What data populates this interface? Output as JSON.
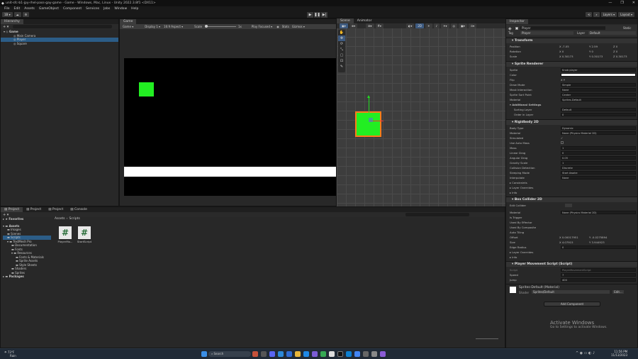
{
  "window": {
    "title": "unit-sfc-b1-jpy-rhel-pass-gay-game - Game - Windows, Mac, Linux - Unity 2022.3.8f1 <DX11>",
    "controls": [
      "—",
      "❐",
      "✕"
    ]
  },
  "menu": [
    "File",
    "Edit",
    "Assets",
    "GameObject",
    "Component",
    "Services",
    "Jobs",
    "Window",
    "Help"
  ],
  "toolbar": {
    "account": "1B",
    "layers": "Layers",
    "layout": "Layout"
  },
  "hierarchy": {
    "tab": "Hierarchy",
    "scene": "Game",
    "items": [
      "Main Camera",
      "Player",
      "Square"
    ]
  },
  "game": {
    "tab": "Game",
    "display_mode": "Game",
    "display": "Display 1",
    "aspect": "16:9 Aspect",
    "scale_label": "Scale",
    "scale_value": "1x",
    "play_focused": "Play Focused",
    "stats": "Stats",
    "gizmos": "Gizmos"
  },
  "scene": {
    "tab_scene": "Scene",
    "tab_animator": "Animator",
    "mode_2d": "2D"
  },
  "inspector": {
    "tab": "Inspector",
    "object_name": "Player",
    "static_label": "Static",
    "tag_label": "Tag",
    "tag_value": "Player",
    "layer_label": "Layer",
    "layer_value": "Default",
    "transform": {
      "title": "Transform",
      "position_label": "Position",
      "position": [
        "-7.05",
        "2.59",
        "0"
      ],
      "rotation_label": "Rotation",
      "rotation": [
        "0",
        "0",
        "0"
      ],
      "scale_label": "Scale",
      "scale": [
        "0.30173",
        "0.30173",
        "0.30173"
      ]
    },
    "sprite_renderer": {
      "title": "Sprite Renderer",
      "sprite_label": "Sprite",
      "sprite_value": "Knob player",
      "color_label": "Color",
      "flip_label": "Flip",
      "flip_value": "X  Y",
      "draw_mode_label": "Draw Mode",
      "draw_mode_value": "Simple",
      "mask_label": "Mask Interaction",
      "mask_value": "None",
      "sort_point_label": "Sprite Sort Point",
      "sort_point_value": "Center",
      "material_label": "Material",
      "material_value": "Sprites-Default",
      "additional_label": "Additional Settings",
      "sorting_layer_label": "Sorting Layer",
      "sorting_layer_value": "Default",
      "order_label": "Order in Layer",
      "order_value": "0"
    },
    "rigidbody": {
      "title": "Rigidbody 2D",
      "body_type_label": "Body Type",
      "body_type_value": "Dynamic",
      "material_label": "Material",
      "material_value": "None (Physics Material 2D)",
      "simulated_label": "Simulated",
      "auto_mass_label": "Use Auto Mass",
      "mass_label": "Mass",
      "mass_value": "1",
      "linear_drag_label": "Linear Drag",
      "linear_drag_value": "0",
      "angular_drag_label": "Angular Drag",
      "angular_drag_value": "0.05",
      "gravity_label": "Gravity Scale",
      "gravity_value": "1",
      "collision_label": "Collision Detection",
      "collision_value": "Discrete",
      "sleeping_label": "Sleeping Mode",
      "sleeping_value": "Start Awake",
      "interpolate_label": "Interpolate",
      "interpolate_value": "None",
      "constraints_label": "Constraints",
      "layer_overrides_label": "Layer Overrides",
      "info_label": "Info"
    },
    "box_collider": {
      "title": "Box Collider 2D",
      "edit_label": "Edit Collider",
      "material_label": "Material",
      "material_value": "None (Physics Material 2D)",
      "trigger_label": "Is Trigger",
      "effector_label": "Used By Effector",
      "composite_label": "Used By Composite",
      "autotiling_label": "Auto Tiling",
      "offset_label": "Offset",
      "offset": [
        "0.00017951",
        "-0.0275894"
      ],
      "size_label": "Size",
      "size": [
        "4.07915",
        "3.944923"
      ],
      "edge_label": "Edge Radius",
      "edge_value": "0",
      "layer_overrides_label": "Layer Overrides",
      "info_label": "Info"
    },
    "script": {
      "title": "Player Movement Script (Script)",
      "script_label": "Script",
      "script_value": "PlayerMovementScript",
      "speed_label": "Speed",
      "speed_value": "7",
      "jump_label": "Jump",
      "jump_value": "400"
    },
    "material": {
      "name": "Sprites-Default (Material)",
      "shader_label": "Shader",
      "shader_value": "Sprites/Default",
      "edit_label": "Edit..."
    },
    "add_component": "Add Component"
  },
  "project": {
    "tabs": [
      "Project",
      "Project",
      "Project",
      "Console"
    ],
    "favorites": "Favorites",
    "assets_label": "Assets",
    "tree": [
      "Assets",
      "Images",
      "Scenes",
      "Scripts",
      "TextMesh Pro",
      "Documentation",
      "Fonts",
      "Resources",
      "Fonts & Materials",
      "Sprite Assets",
      "Style Sheets",
      "Shaders",
      "Sprites",
      "Packages"
    ],
    "breadcrumb": [
      "Assets",
      "Scripts"
    ],
    "files": [
      "PlayerMo...",
      "StartScript"
    ]
  },
  "watermark": {
    "line1": "Activate Windows",
    "line2": "Go to Settings to activate Windows."
  },
  "taskbar": {
    "weather_temp": "73°F",
    "weather_desc": "Rain",
    "search": "Search",
    "time": "11:56 PM",
    "date": "11/13/2023"
  },
  "colors": {
    "player_green": "#22ee22",
    "selection_blue": "#2c5d87",
    "collider_outline": "#ff7a1a"
  }
}
